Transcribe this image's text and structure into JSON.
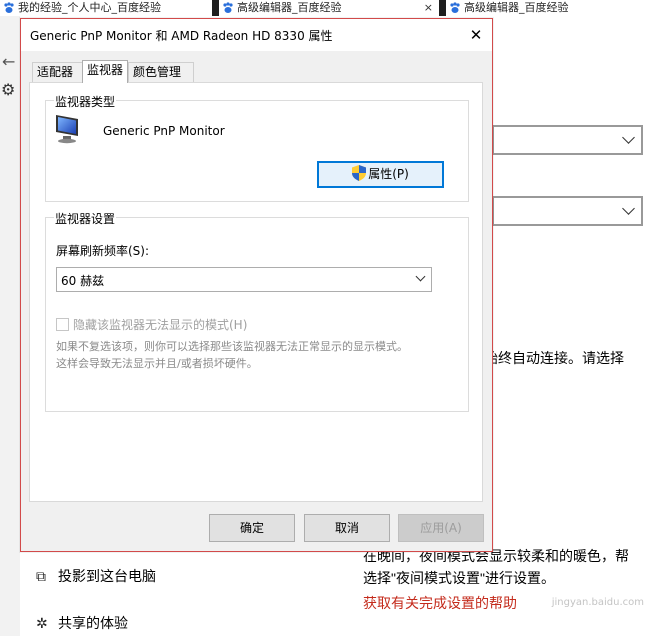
{
  "browser_tabs": [
    {
      "label": "我的经验_个人中心_百度经验"
    },
    {
      "label": "高级编辑器_百度经验",
      "close": "×"
    },
    {
      "label": "高级编辑器_百度经验"
    }
  ],
  "settings_bg": {
    "back_glyph": "←",
    "gear_glyph": "⚙",
    "partial_line": "络始终自动连接。请选择",
    "nightlight_line1": "在晚间，夜间模式会显示较柔和的暖色，帮",
    "nightlight_line2": "选择\"夜间模式设置\"进行设置。",
    "help_link": "获取有关完成设置的帮助",
    "nav": [
      {
        "icon": "⧉",
        "label": "投影到这台电脑"
      },
      {
        "icon": "✲",
        "label": "共享的体验"
      }
    ],
    "watermark": "jingyan.baidu.com"
  },
  "dialog": {
    "title": "Generic PnP Monitor 和 AMD Radeon HD 8330 属性",
    "close": "✕",
    "tabs": [
      {
        "label": "适配器"
      },
      {
        "label": "监视器"
      },
      {
        "label": "颜色管理"
      }
    ],
    "monitor_type": {
      "group_label": "监视器类型",
      "monitor_name": "Generic PnP Monitor",
      "properties_button": "属性(P)"
    },
    "monitor_settings": {
      "group_label": "监视器设置",
      "refresh_label": "屏幕刷新频率(S):",
      "refresh_value": "60 赫兹",
      "hide_modes_label": "隐藏该监视器无法显示的模式(H)",
      "hide_modes_checked": false,
      "desc_line1": "如果不复选该项，则你可以选择那些该监视器无法正常显示的显示模式。",
      "desc_line2": "这样会导致无法显示并且/或者损坏硬件。"
    },
    "buttons": {
      "ok": "确定",
      "cancel": "取消",
      "apply": "应用(A)"
    }
  },
  "colors": {
    "accent": "#0078d7",
    "dialog_border": "#d24a4a",
    "link_red": "#c42b1c"
  }
}
